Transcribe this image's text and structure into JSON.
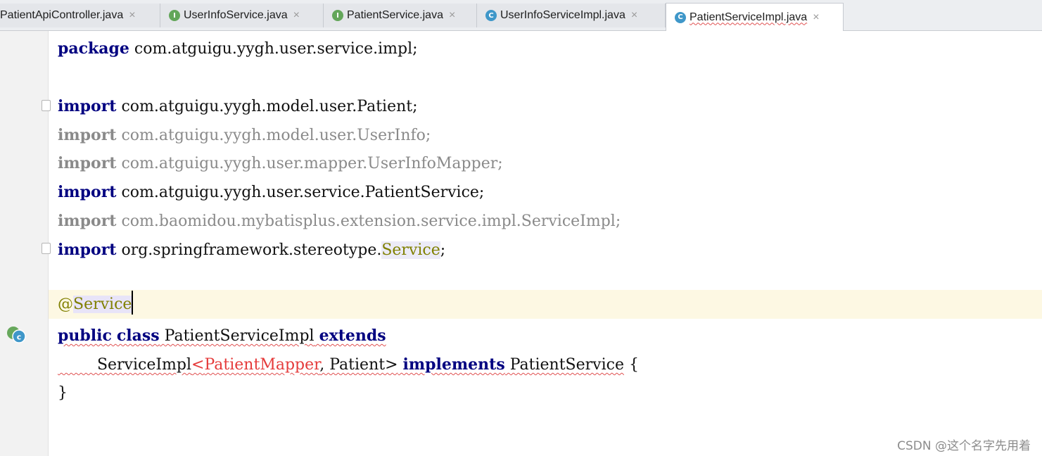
{
  "tabs": [
    {
      "label": "PatientApiController.java",
      "icon": "",
      "close": "×",
      "active": false
    },
    {
      "label": "UserInfoService.java",
      "icon": "I",
      "close": "×",
      "active": false
    },
    {
      "label": "PatientService.java",
      "icon": "I",
      "close": "×",
      "active": false
    },
    {
      "label": "UserInfoServiceImpl.java",
      "icon": "C",
      "close": "×",
      "active": false
    },
    {
      "label": "PatientServiceImpl.java",
      "icon": "C",
      "close": "×",
      "active": true
    }
  ],
  "code": {
    "l1": {
      "kw": "package",
      "rest": " com.atguigu.yygh.user.service.impl;"
    },
    "l3": {
      "kw": "import",
      "rest": " com.atguigu.yygh.model.user.Patient;"
    },
    "l4": {
      "kw": "import",
      "rest": " com.atguigu.yygh.model.user.UserInfo;"
    },
    "l5": {
      "kw": "import",
      "rest": " com.atguigu.yygh.user.mapper.UserInfoMapper;"
    },
    "l6": {
      "kw": "import",
      "rest": " com.atguigu.yygh.user.service.PatientService;"
    },
    "l7": {
      "kw": "import",
      "rest": " com.baomidou.mybatisplus.extension.service.impl.ServiceImpl;"
    },
    "l8": {
      "kw": "import",
      "pre": " org.springframework.stereotype.",
      "hl": "Service",
      "post": ";"
    },
    "l10": {
      "at": "@",
      "name": "Service"
    },
    "l11": {
      "kw1": "public",
      "kw2": "class",
      "name": "PatientServiceImpl",
      "kw3": "extends"
    },
    "l12": {
      "indent": "        ",
      "base": "ServiceImpl",
      "lt": "<",
      "mapper": "PatientMapper",
      "mid": ", Patient>",
      "kw": "implements",
      "iface": "PatientService",
      "brace": "{"
    },
    "l13": {
      "brace": "}"
    }
  },
  "watermark": "CSDN @这个名字先用着",
  "colors": {
    "keyword": "#000080",
    "annotation": "#808000",
    "error": "#e53b3b",
    "unused": "#8a8a8a",
    "current_line": "#fdf8e3"
  }
}
